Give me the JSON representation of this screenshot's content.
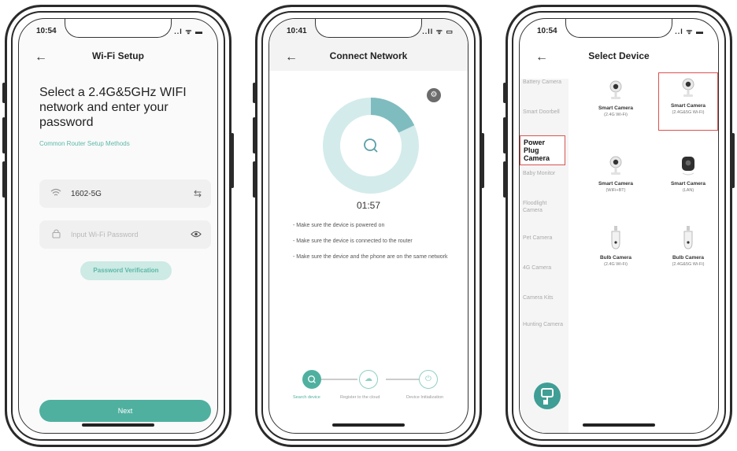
{
  "screen1": {
    "time": "10:54",
    "status_icons": "..l ᯤ ▬",
    "nav_title": "Wi-Fi Setup",
    "headline": "Select a 2.4G&5GHz WIFI network and enter your password",
    "router_link": "Common Router Setup Methods",
    "ssid_value": "1602-5G",
    "password_placeholder": "Input Wi-Fi Password",
    "verify_label": "Password Verification",
    "next_label": "Next"
  },
  "screen2": {
    "time": "10:41",
    "status_icons": "..ll ᯤ ▭",
    "nav_title": "Connect Network",
    "timer": "01:57",
    "progress": 0.18,
    "tips": [
      "- Make sure the device is powered on",
      "- Make sure the device is connected to the router",
      "- Make sure the device and the phone are on the same network"
    ],
    "steps": [
      {
        "label": "Search device"
      },
      {
        "label": "Register to the cloud"
      },
      {
        "label": "Device Initialization"
      }
    ]
  },
  "screen3": {
    "time": "10:54",
    "status_icons": "..l ᯤ ▬",
    "nav_title": "Select Device",
    "categories": [
      "Battery Camera",
      "Smart Doorbell",
      "Power Plug Camera",
      "Baby Monitor",
      "Floodlight Camera",
      "Pet Camera",
      "4G Camera",
      "Camera Kits",
      "Hunting Camera"
    ],
    "devices": [
      {
        "name": "Smart Camera",
        "sub": "(2.4G Wi-Fi)"
      },
      {
        "name": "Smart Camera",
        "sub": "(2.4G&5G Wi-Fi)"
      },
      {
        "name": "Smart Camera",
        "sub": "(WiFi+BT)"
      },
      {
        "name": "Smart Camera",
        "sub": "(LAN)"
      },
      {
        "name": "Bulb Camera",
        "sub": "(2.4G Wi-Fi)"
      },
      {
        "name": "Bulb Camera",
        "sub": "(2.4G&5G Wi-Fi)"
      }
    ]
  },
  "colors": {
    "accent": "#4fb0a0",
    "accent_light": "#cdeae4",
    "highlight": "#d9534f"
  }
}
